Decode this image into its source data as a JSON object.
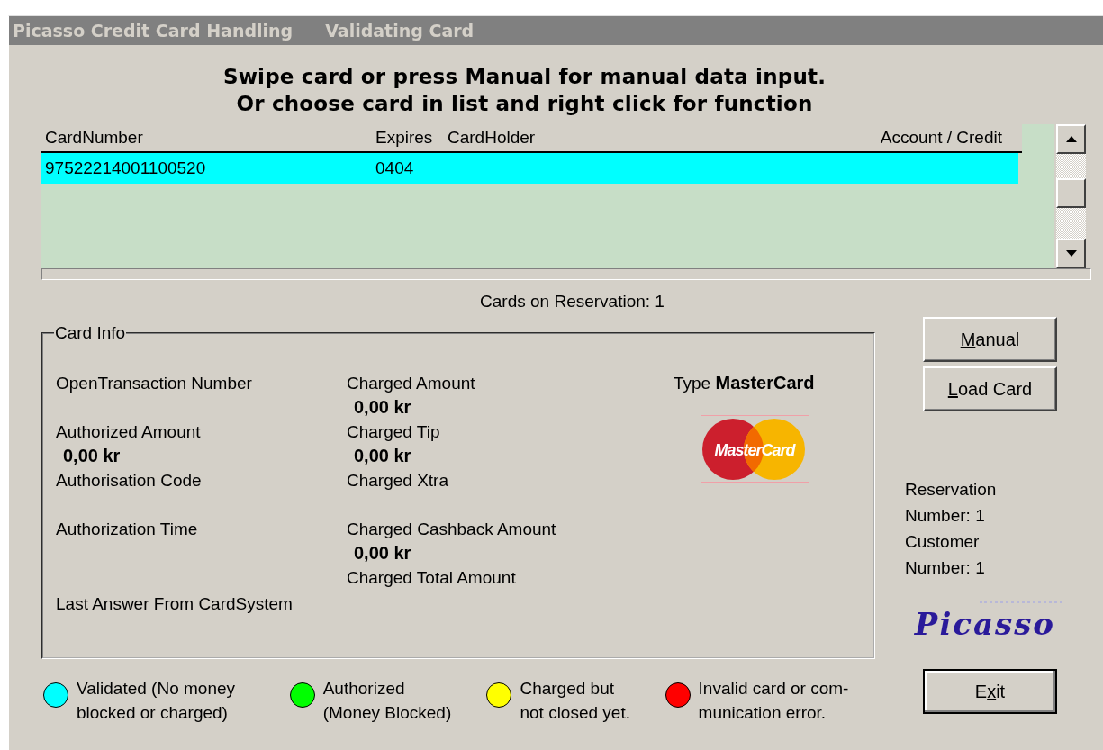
{
  "window": {
    "title": "Picasso Credit Card Handling",
    "subtitle": "Validating Card"
  },
  "instructions": [
    "Swipe card or press Manual for manual data input.",
    "Or choose card in list and right click for function"
  ],
  "card_list": {
    "columns": [
      {
        "label": "CardNumber"
      },
      {
        "label": "Expires"
      },
      {
        "label": "CardHolder"
      },
      {
        "label": "Account / Credit"
      }
    ],
    "rows": [
      {
        "cells": [
          "97522214001100520",
          "0404"
        ],
        "selected": true
      }
    ]
  },
  "cards_on_reservation": "Cards on Reservation: 1",
  "card_info": {
    "title": "Card Info",
    "left_fields": [
      {
        "label": "OpenTransaction Number"
      },
      {
        "label": "Authorized Amount",
        "value": "0,00 kr"
      },
      {
        "label": "Authorisation Code"
      },
      {
        "label": "Authorization Time"
      }
    ],
    "middle_fields": [
      {
        "label": "Charged Amount",
        "value": "0,00 kr"
      },
      {
        "label": "Charged Tip",
        "value": "0,00 kr"
      },
      {
        "label": "Charged Xtra"
      },
      {
        "label": "Charged Cashback Amount",
        "value": "0,00 kr"
      },
      {
        "label": "Charged Total Amount"
      }
    ],
    "last_answer": "Last Answer From CardSystem",
    "type_label": "Type",
    "type_value": "MasterCard",
    "logo_text": "MasterCard"
  },
  "buttons": [
    {
      "key": "M",
      "post": "anual"
    },
    {
      "key": "L",
      "post": "oad Card"
    }
  ],
  "reservation": [
    "Reservation",
    "Number: 1",
    "Customer",
    "Number: 1"
  ],
  "brand_logo": "Picasso",
  "legend": [
    {
      "color": "#00ffff",
      "text": "Validated (No money\nblocked or charged)"
    },
    {
      "color": "#00ff00",
      "text": "Authorized\n(Money Blocked)"
    },
    {
      "color": "#ffff00",
      "text": "Charged but\nnot closed yet."
    },
    {
      "color": "#ff0000",
      "text": "Invalid card or com-\nmunication error."
    }
  ],
  "exit_button": {
    "pre": "E",
    "key": "x",
    "post": "it"
  }
}
